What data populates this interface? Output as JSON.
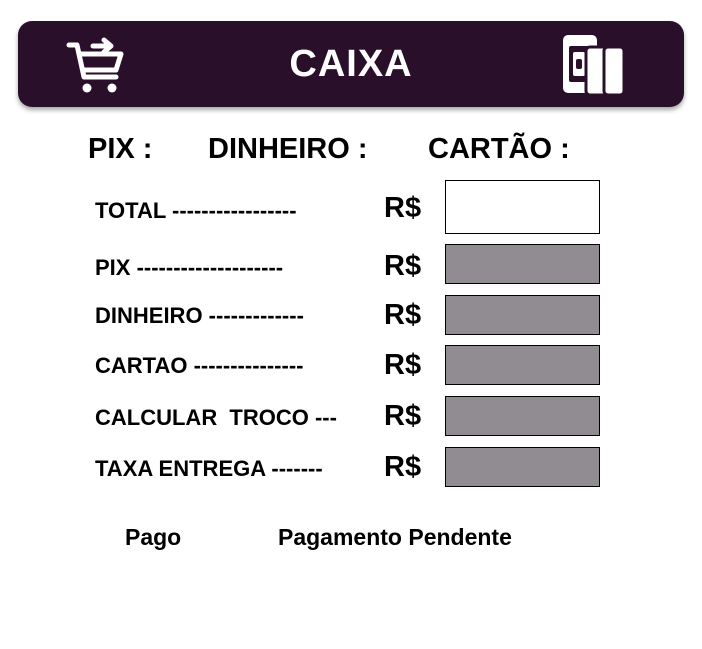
{
  "colors": {
    "header_bg": "#2a0f2a",
    "header_text": "#ffffff",
    "field_filled": "#918c91",
    "field_empty": "#ffffff"
  },
  "header": {
    "title": "CAIXA",
    "left_icon": "cart-arrow-icon",
    "right_icon": "wallet-cards-icon"
  },
  "payment_methods": [
    {
      "label": "PIX :"
    },
    {
      "label": "DINHEIRO :"
    },
    {
      "label": "CARTÃO :"
    }
  ],
  "rows": [
    {
      "label": "TOTAL -----------------",
      "currency": "R$",
      "value": ""
    },
    {
      "label": "PIX --------------------",
      "currency": "R$",
      "value": ""
    },
    {
      "label": "DINHEIRO -------------",
      "currency": "R$",
      "value": ""
    },
    {
      "label": "CARTAO ---------------",
      "currency": "R$",
      "value": ""
    },
    {
      "label": "CALCULAR  TROCO ---",
      "currency": "R$",
      "value": ""
    },
    {
      "label": "TAXA ENTREGA -------",
      "currency": "R$",
      "value": ""
    }
  ],
  "status": {
    "paid": "Pago",
    "pending": "Pagamento Pendente"
  }
}
